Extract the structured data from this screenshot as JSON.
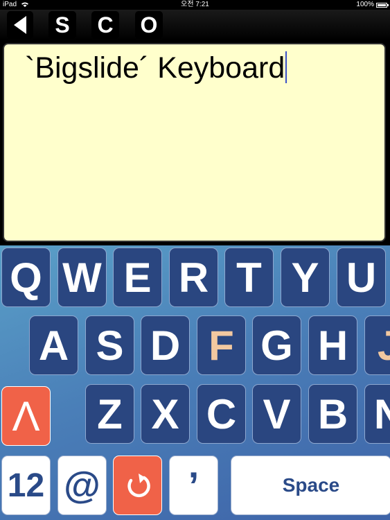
{
  "status_bar": {
    "device": "iPad",
    "time": "오전 7:21",
    "battery": "100%"
  },
  "toolbar": {
    "back_icon": "back-arrow-icon",
    "buttons": [
      "S",
      "C",
      "O"
    ]
  },
  "editor": {
    "text": "`Bigslide´ Keyboard"
  },
  "keyboard": {
    "row1": [
      "Q",
      "W",
      "E",
      "R",
      "T",
      "Y",
      "U"
    ],
    "row2": [
      "A",
      "S",
      "D",
      "F",
      "G",
      "H",
      "J"
    ],
    "row3": [
      "Z",
      "X",
      "C",
      "V",
      "B",
      "N"
    ],
    "shift_label": "Λ",
    "bottom": {
      "numbers_label": "12",
      "at_label": "@",
      "undo_label": "↻",
      "apostrophe_label": "ʼ",
      "space_label": "Space"
    },
    "highlight_color": "#f2c8a0",
    "accent_red": "#f06248",
    "key_blue": "#2a4680"
  }
}
